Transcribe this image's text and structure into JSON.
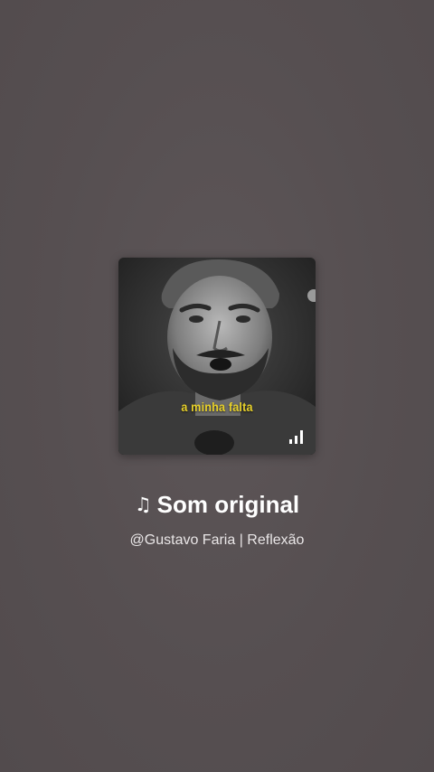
{
  "cover": {
    "caption": "a minha falta",
    "icon": "signal-bars-icon"
  },
  "sound": {
    "note_icon": "♫",
    "title": "Som original",
    "author": "@Gustavo Faria | Reflexão"
  },
  "colors": {
    "background": "#575052",
    "caption_yellow": "#e8d12a",
    "text_primary": "#ffffff"
  }
}
